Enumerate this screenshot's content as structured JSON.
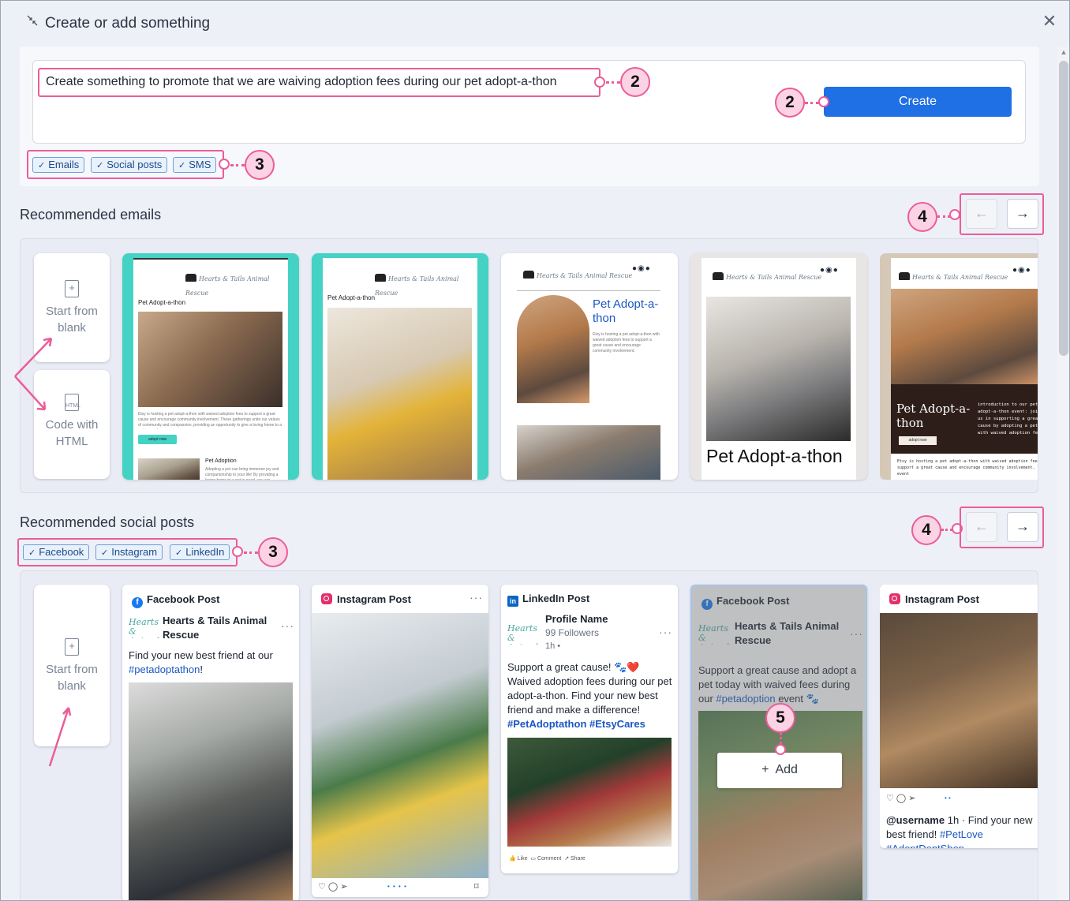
{
  "header": {
    "title": "Create or add something",
    "minimize_icon": "collapse-arrows-icon",
    "close_icon": "close-icon",
    "close_glyph": "✕"
  },
  "prompt": {
    "value": "Create something to promote that we are waiving adoption fees during our pet adopt-a-thon",
    "create_label": "Create",
    "channels": [
      "Emails",
      "Social posts",
      "SMS"
    ]
  },
  "annotations": {
    "prompt_badge": "2",
    "create_badge": "2",
    "channels_badge": "3",
    "email_nav_badge": "4",
    "social_nav_badge": "4",
    "social_channels_badge": "3",
    "add_badge": "5"
  },
  "emails": {
    "title": "Recommended emails",
    "prev_glyph": "←",
    "next_glyph": "→",
    "start_blank_label": "Start from blank",
    "code_html_label": "Code with HTML",
    "html_icon_text": "HTML",
    "cards": [
      {
        "brand": "Hearts & Tails Animal Rescue",
        "heading": "Pet Adopt-a-thon",
        "button": "adopt now",
        "subheading": "Pet Adoption",
        "body": "Etsy is hosting a pet adopt-a-thon with waived adoption fees to support a great cause and encourage community involvement. These gatherings unite our values of community and compassion, providing an opportunity to give a loving home to a pet in need.",
        "sub_body": "Adopting a pet can bring immense joy and companionship to your life! By providing a loving home to a pet in need, you are contributing to a kinder world."
      },
      {
        "brand": "Hearts & Tails Animal Rescue",
        "heading": "Pet Adopt-a-thon"
      },
      {
        "brand": "Hearts & Tails Animal Rescue",
        "heading": "Pet Adopt-a-thon",
        "body": "Etsy is hosting a pet adopt-a-thon with waived adoption fees to support a great cause and encourage community involvement."
      },
      {
        "brand": "Hearts & Tails Animal Rescue",
        "heading": "Pet Adopt-a-thon"
      },
      {
        "brand": "Hearts & Tails Animal Rescue",
        "heading": "Pet Adopt-a-thon",
        "button": "adopt now",
        "side_text": "introduction to our pet adopt-a-thon event: join us in supporting a great cause by adopting a pet with waived adoption fees",
        "footer": "Etsy is hosting a pet adopt-a-thon with waived adoption fees to support a great cause and encourage community involvement. This event"
      }
    ]
  },
  "social": {
    "title": "Recommended social posts",
    "prev_glyph": "←",
    "next_glyph": "→",
    "channels": [
      "Facebook",
      "Instagram",
      "LinkedIn"
    ],
    "start_blank_label": "Start from blank",
    "add_label": "Add",
    "add_glyph": "+",
    "cards": [
      {
        "type": "Facebook Post",
        "brand_logo": "Hearts & Animal R",
        "account": "Hearts & Tails Animal Rescue",
        "text_pre": "Find your new best friend at our ",
        "hashtag": "#petadoptathon",
        "text_post": "!"
      },
      {
        "type": "Instagram Post",
        "page_dots": "• • • •"
      },
      {
        "type": "LinkedIn Post",
        "brand_logo": "Hearts & Animal R",
        "account": "Profile Name",
        "followers": "99 Followers",
        "time": "1h •",
        "text": "Support a great cause! 🐾❤️ Waived adoption fees during our pet adopt-a-thon. Find your new best friend and make a difference!",
        "hashtags": "#PetAdoptathon #EtsyCares",
        "actions": [
          "Like",
          "Comment",
          "Share"
        ]
      },
      {
        "type": "Facebook Post",
        "brand_logo": "Hearts & Animal R",
        "account": "Hearts & Tails Animal Rescue",
        "text_pre": "Support a great cause and adopt a pet today with waived fees during our ",
        "hashtag": "#petadoption",
        "text_post": " event 🐾"
      },
      {
        "type": "Instagram Post",
        "username": "@username",
        "time": "1h",
        "text": " · Find your new best friend! ",
        "hashtags": "#PetLove #AdoptDontShop"
      }
    ]
  },
  "colors": {
    "accent": "#1f6fe5",
    "annotation": "#ec5d98",
    "annotation_fill": "#fbd3e4",
    "teal": "#44d2c5",
    "facebook": "#1877f2",
    "instagram": "#e1306c",
    "linkedin": "#0a66c2"
  }
}
